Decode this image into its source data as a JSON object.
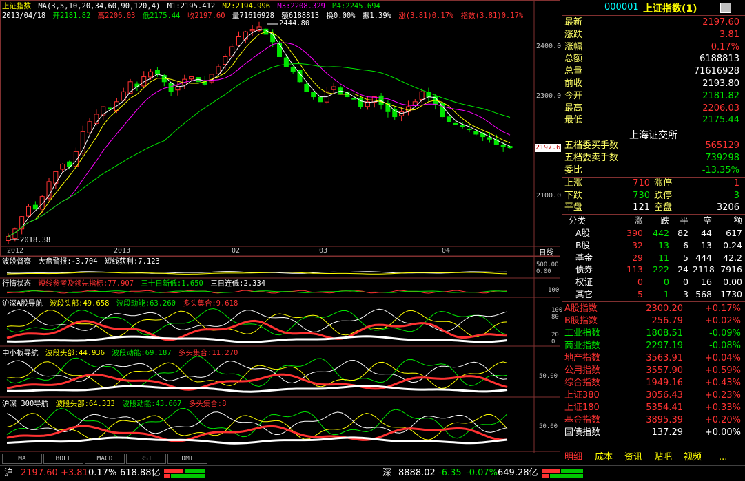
{
  "main_chart": {
    "header1": {
      "name": "上证指数",
      "ma": "MA(3,5,10,20,34,60,90,120,4)",
      "m1": "M1:2195.412",
      "m2": "M2:2194.996",
      "m3": "M3:2208.329",
      "m4": "M4:2245.694"
    },
    "header2": {
      "date": "2013/04/18",
      "open": "开2181.82",
      "high": "高2206.03",
      "low": "低2175.44",
      "close": "收2197.60",
      "vol": "量71616928",
      "amt": "额6188813",
      "turn": "换0.00%",
      "amp": "振1.39%",
      "chg": "涨(3.81)0.17%",
      "idx": "指数(3.81)0.17%"
    },
    "price_axis": [
      "2400.0",
      "2300.0",
      "2100.0"
    ],
    "current_price_tag": "2197.6",
    "high_mark": "2444.80",
    "low_mark": "2018.38",
    "time_axis": [
      "2012",
      "2013",
      "02",
      "03",
      "04"
    ],
    "period": "日线"
  },
  "panels": {
    "p1": {
      "title": "波段督察",
      "a": "大盘警报:-3.704",
      "b": "短线获利:7.123",
      "axis": [
        "500.00",
        "0.00"
      ]
    },
    "p2": {
      "title": "行情状态",
      "a": "短线参考及领先指标:77.907",
      "b": "三十日新低:1.650",
      "c": "三日连低:2.334",
      "axis": [
        "100"
      ]
    },
    "p3": {
      "title": "沪深A股导航",
      "a": "波段头部:49.658",
      "b": "波段动能:63.260",
      "c": "多头集合:9.618",
      "axis": [
        "100",
        "80",
        "20",
        "0"
      ]
    },
    "p4": {
      "title": "中小板导航",
      "a": "波段头部:44.936",
      "b": "波段动能:69.187",
      "c": "多头集合:11.270",
      "axis": [
        "50.00"
      ]
    },
    "p5": {
      "title": "沪深 300导航",
      "a": "波段头部:64.333",
      "b": "波段动能:43.667",
      "c": "多头集合:8",
      "axis": [
        "50.00"
      ]
    }
  },
  "bottom_tabs": [
    "MA",
    "BOLL",
    "MACD",
    "RSI",
    "DMI"
  ],
  "quote": {
    "code": "000001",
    "name": "上证指数(1)",
    "rows": [
      {
        "label": "最新",
        "value": "2197.60",
        "color": "red"
      },
      {
        "label": "涨跌",
        "value": "3.81",
        "color": "red"
      },
      {
        "label": "涨幅",
        "value": "0.17%",
        "color": "red"
      },
      {
        "label": "总额",
        "value": "6188813",
        "color": "wht"
      },
      {
        "label": "总量",
        "value": "71616928",
        "color": "wht"
      },
      {
        "label": "前收",
        "value": "2193.80",
        "color": "wht"
      },
      {
        "label": "今开",
        "value": "2181.82",
        "color": "grn"
      },
      {
        "label": "最高",
        "value": "2206.03",
        "color": "red"
      },
      {
        "label": "最低",
        "value": "2175.44",
        "color": "grn"
      }
    ],
    "exchange": "上海证交所",
    "rows2": [
      {
        "label": "五档委买手数",
        "value": "565129",
        "color": "red"
      },
      {
        "label": "五档委卖手数",
        "value": "739298",
        "color": "grn"
      },
      {
        "label": "委比",
        "value": "-13.35%",
        "color": "grn"
      }
    ],
    "updown": {
      "up_l": "上涨",
      "up_v": "710",
      "lim_up_l": "涨停",
      "lim_up_v": "1",
      "dn_l": "下跌",
      "dn_v": "730",
      "lim_dn_l": "跌停",
      "lim_dn_v": "3",
      "fl_l": "平盘",
      "fl_v": "121",
      "stop_l": "空盘",
      "stop_v": "3206"
    },
    "cat_header": [
      "分类",
      "涨",
      "跌",
      "平",
      "空",
      "额"
    ],
    "cats": [
      [
        "A股",
        "390",
        "442",
        "82",
        "44",
        "617"
      ],
      [
        "B股",
        "32",
        "13",
        "6",
        "13",
        "0.24"
      ],
      [
        "基金",
        "29",
        "11",
        "5",
        "444",
        "42.2"
      ],
      [
        "债券",
        "113",
        "222",
        "24",
        "2118",
        "7916"
      ],
      [
        "权证",
        "0",
        "0",
        "0",
        "16",
        "0.00"
      ],
      [
        "其它",
        "5",
        "1",
        "3",
        "568",
        "1730"
      ]
    ],
    "indices": [
      {
        "name": "A股指数",
        "value": "2300.20",
        "chg": "+0.17%",
        "color": "red"
      },
      {
        "name": "B股指数",
        "value": "256.79",
        "chg": "+0.02%",
        "color": "red"
      },
      {
        "name": "工业指数",
        "value": "1808.51",
        "chg": "-0.09%",
        "color": "grn"
      },
      {
        "name": "商业指数",
        "value": "2297.19",
        "chg": "-0.08%",
        "color": "grn"
      },
      {
        "name": "地产指数",
        "value": "3563.91",
        "chg": "+0.04%",
        "color": "red"
      },
      {
        "name": "公用指数",
        "value": "3557.90",
        "chg": "+0.59%",
        "color": "red"
      },
      {
        "name": "综合指数",
        "value": "1949.16",
        "chg": "+0.43%",
        "color": "red"
      },
      {
        "name": "上证380",
        "value": "3056.43",
        "chg": "+0.23%",
        "color": "red"
      },
      {
        "name": "上证180",
        "value": "5354.41",
        "chg": "+0.33%",
        "color": "red"
      },
      {
        "name": "基金指数",
        "value": "3895.39",
        "chg": "+0.20%",
        "color": "red"
      },
      {
        "name": "国债指数",
        "value": "137.29",
        "chg": "+0.00%",
        "color": "wht"
      }
    ],
    "tabs": [
      "明细",
      "成本",
      "资讯",
      "贴吧",
      "视频",
      "..."
    ]
  },
  "status": {
    "sh_label": "沪",
    "sh_price": "2197.60",
    "sh_chg": "+3.81",
    "sh_pct": "0.17%",
    "sh_amt": "618.88亿",
    "sz_label": "深",
    "sz_price": "8888.02",
    "sz_chg": "-6.35",
    "sz_pct": "-0.07%",
    "sz_amt": "649.28亿"
  },
  "colors": {
    "up": "#ff3232",
    "down": "#00e600",
    "label": "#ffff66",
    "border": "#803030"
  }
}
